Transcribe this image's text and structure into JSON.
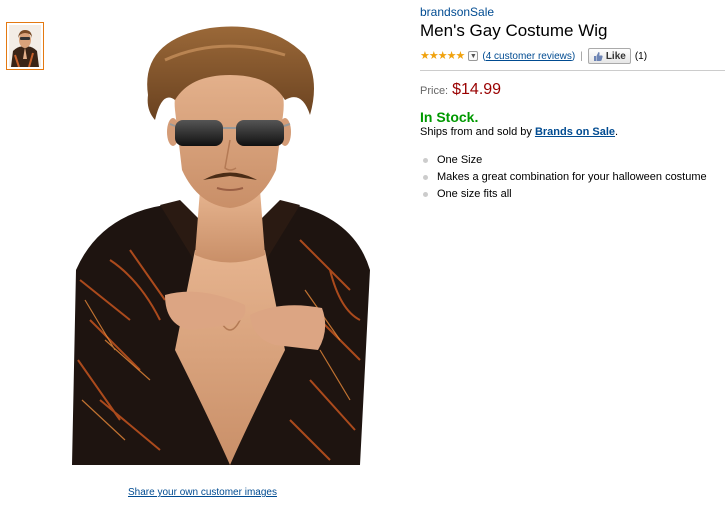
{
  "product": {
    "brand": "brandsonSale",
    "title": "Men's Gay Costume Wig",
    "rating_stars": 5,
    "reviews_link": "4 customer reviews",
    "reviews_open": "(",
    "reviews_close": ")",
    "separator": "|",
    "like_label": "Like",
    "like_count": "(1)",
    "price_label": "Price:",
    "price": "$14.99",
    "stock": "In Stock.",
    "ships_prefix": "Ships from and sold by ",
    "seller": "Brands on Sale",
    "ships_suffix": ".",
    "features": [
      "One Size",
      "Makes a great combination for your halloween costume",
      "One size fits all"
    ]
  },
  "gallery": {
    "share_link": "Share your own customer images"
  },
  "colors": {
    "link": "#004b91",
    "price": "#990000",
    "stock": "#009900",
    "star": "#f0a20e",
    "thumb_border": "#e47911"
  }
}
